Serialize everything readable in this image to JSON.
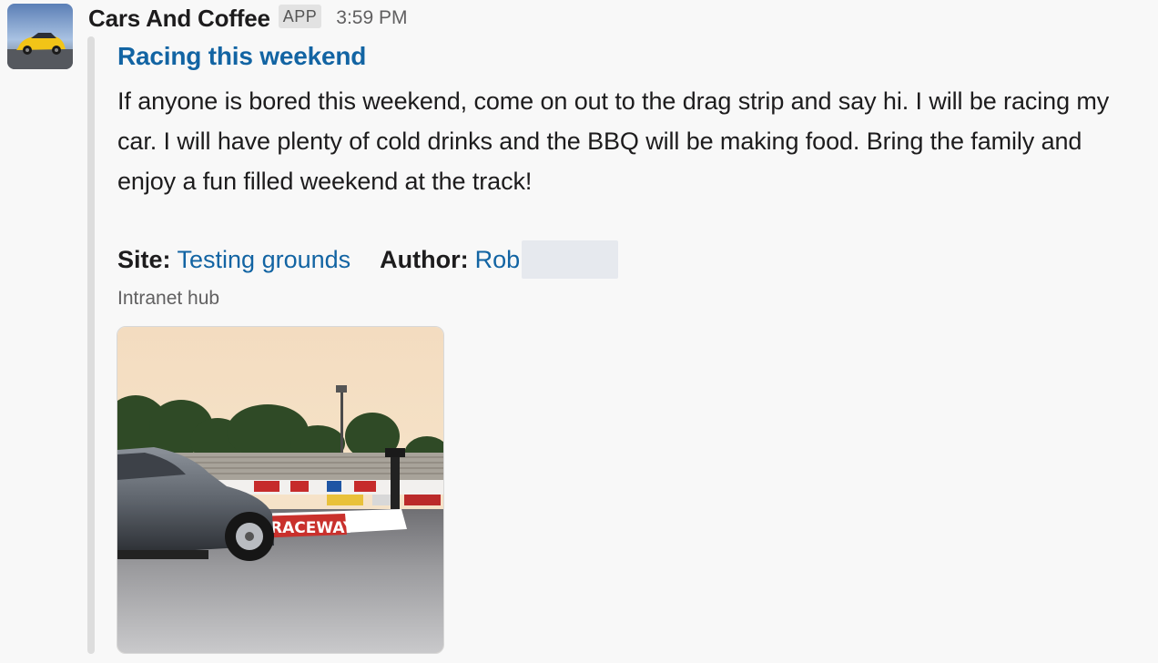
{
  "message": {
    "sender": "Cars And Coffee",
    "badge": "APP",
    "timestamp": "3:59 PM"
  },
  "attachment": {
    "title": "Racing this weekend",
    "body": "If anyone is bored this weekend, come on out to the drag strip and say hi. I will be racing my car. I will have plenty of cold drinks and the BBQ will be making food. Bring the family and enjoy a fun filled weekend at the track!",
    "fields": {
      "site_label": "Site:",
      "site_value": "Testing grounds",
      "author_label": "Author:",
      "author_value": "Rob"
    },
    "footer": "Intranet hub",
    "image_signage": "RACEWAY"
  },
  "colors": {
    "link": "#1264a3",
    "bar": "#dddddd",
    "background": "#f8f8f8"
  },
  "icons": {
    "avatar": "yellow-sports-car-avatar",
    "image": "drag-racing-car-photo"
  }
}
